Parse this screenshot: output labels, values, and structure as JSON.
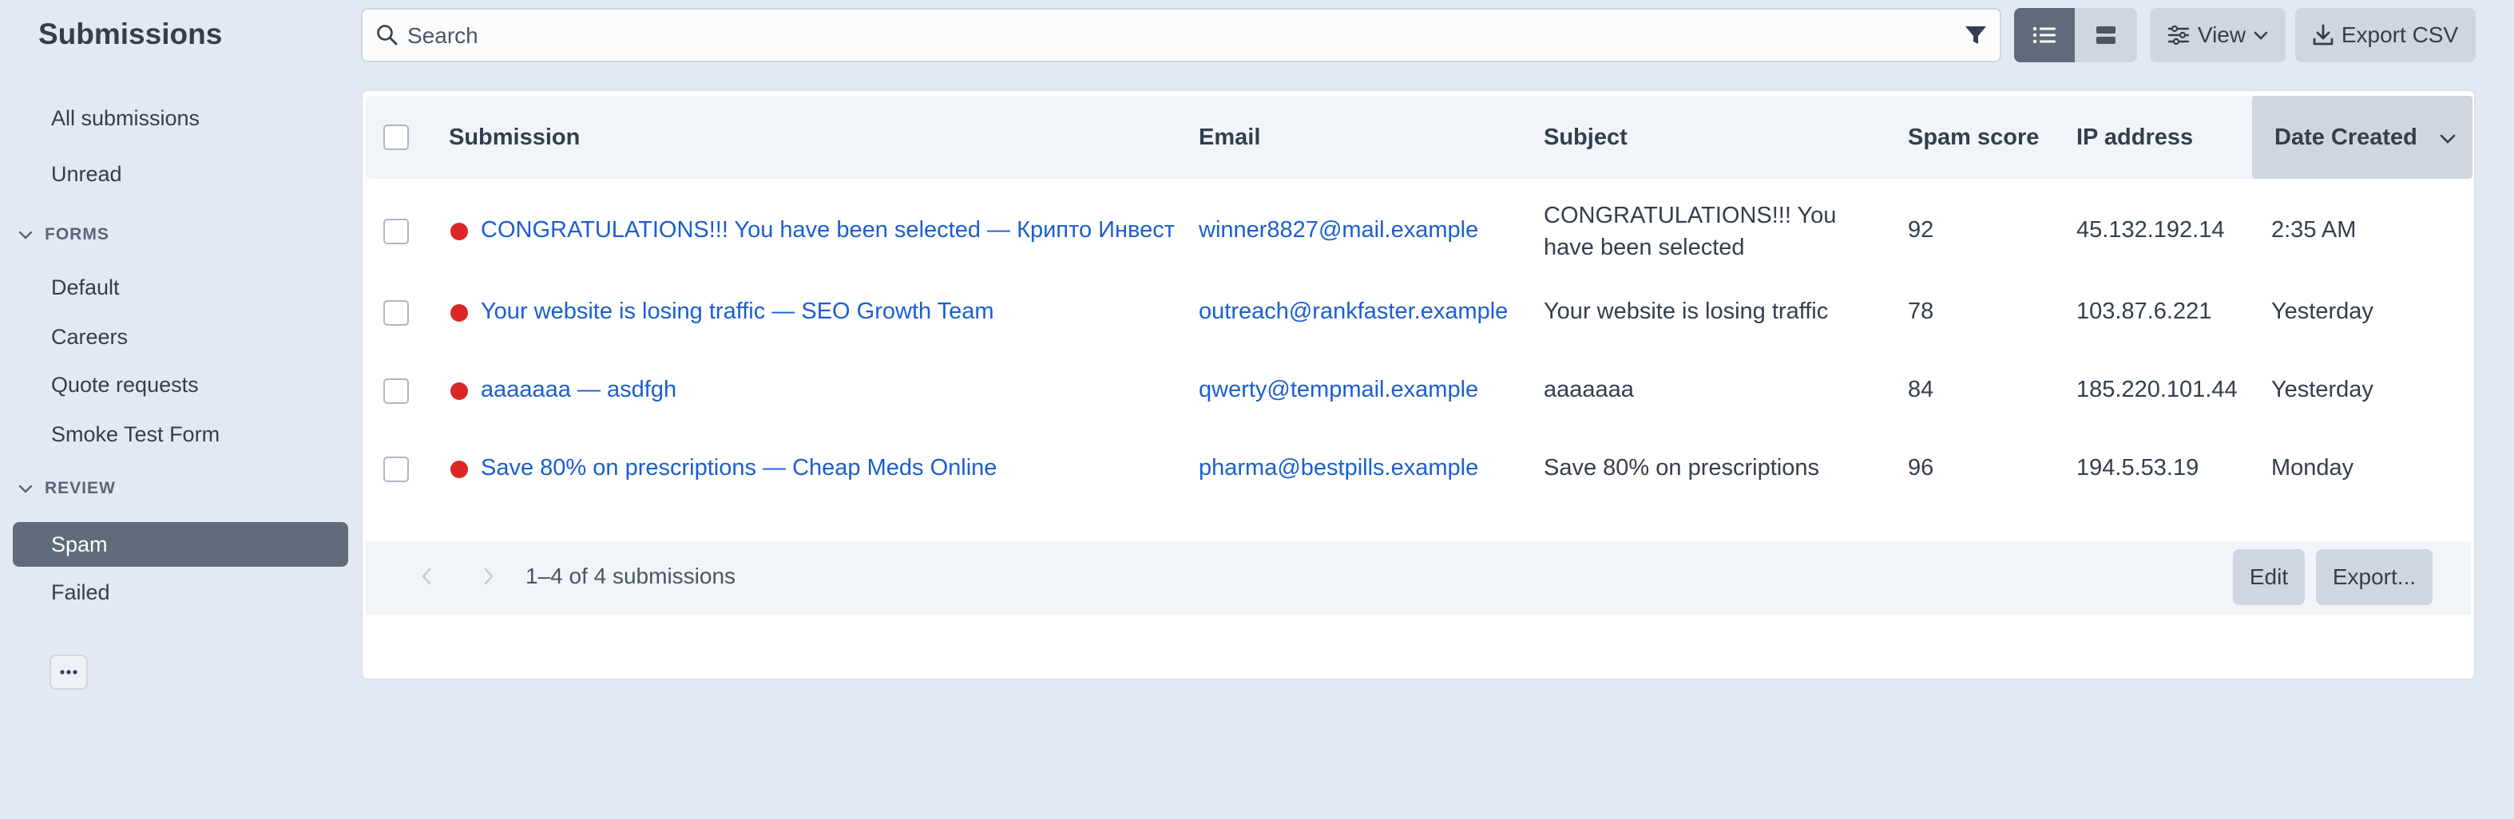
{
  "app": {
    "title": "Submissions"
  },
  "sidebar": {
    "top_items": [
      {
        "label": "All submissions"
      },
      {
        "label": "Unread"
      }
    ],
    "sections": [
      {
        "heading": "FORMS",
        "items": [
          {
            "label": "Default"
          },
          {
            "label": "Careers"
          },
          {
            "label": "Quote requests"
          },
          {
            "label": "Smoke Test Form"
          }
        ]
      },
      {
        "heading": "REVIEW",
        "items": [
          {
            "label": "Spam",
            "active": true
          },
          {
            "label": "Failed"
          }
        ]
      }
    ],
    "more_label": "•••"
  },
  "toolbar": {
    "search_placeholder": "Search",
    "view_label": "View",
    "export_csv_label": "Export CSV"
  },
  "table": {
    "columns": [
      "Submission",
      "Email",
      "Subject",
      "Spam score",
      "IP address",
      "Date Created"
    ],
    "sorted_column": "Date Created",
    "rows": [
      {
        "submission": "CONGRATULATIONS!!! You have been selected — Крипто Инвест",
        "email": "winner8827@mail.example",
        "subject": "CONGRATULATIONS!!! You have been selected",
        "spam_score": "92",
        "ip": "45.132.192.14",
        "date": "2:35 AM"
      },
      {
        "submission": "Your website is losing traffic — SEO Growth Team",
        "email": "outreach@rankfaster.example",
        "subject": "Your website is losing traffic",
        "spam_score": "78",
        "ip": "103.87.6.221",
        "date": "Yesterday"
      },
      {
        "submission": "aaaaaaa — asdfgh",
        "email": "qwerty@tempmail.example",
        "subject": "aaaaaaa",
        "spam_score": "84",
        "ip": "185.220.101.44",
        "date": "Yesterday"
      },
      {
        "submission": "Save 80% on prescriptions — Cheap Meds Online",
        "email": "pharma@bestpills.example",
        "subject": "Save 80% on prescriptions",
        "spam_score": "96",
        "ip": "194.5.53.19",
        "date": "Monday"
      }
    ]
  },
  "footer": {
    "count_text": "1–4 of 4 submissions",
    "edit_label": "Edit",
    "export_label": "Export..."
  },
  "colors": {
    "background": "#e3e9f2",
    "active_nav": "#5f6b7a",
    "link": "#1a5fd0",
    "spam_dot": "#dc2626"
  }
}
